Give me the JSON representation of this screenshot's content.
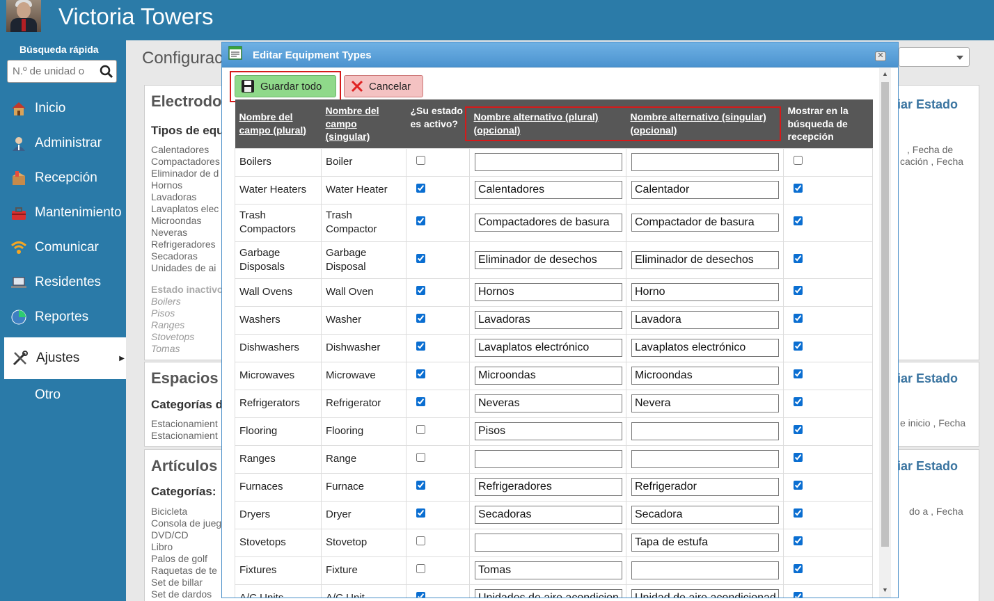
{
  "app": {
    "title": "Victoria Towers"
  },
  "quick_search": {
    "label": "Búsqueda rápida",
    "placeholder": "N.º de unidad o"
  },
  "nav": [
    {
      "label": "Inicio",
      "icon": "house-icon"
    },
    {
      "label": "Administrar",
      "icon": "user-icon"
    },
    {
      "label": "Recepción",
      "icon": "package-icon"
    },
    {
      "label": "Mantenimiento",
      "icon": "toolbox-icon"
    },
    {
      "label": "Comunicar",
      "icon": "wifi-icon"
    },
    {
      "label": "Residentes",
      "icon": "laptop-icon"
    },
    {
      "label": "Reportes",
      "icon": "pie-chart-icon"
    },
    {
      "label": "Ajustes",
      "icon": "tools-icon",
      "active": true
    },
    {
      "label": "Otro"
    }
  ],
  "background": {
    "title": "Configurac",
    "cards": [
      {
        "title": "Electrodo",
        "subtitle": "Tipos de equ",
        "status": "biar Estado",
        "items": [
          "Calentadores",
          "Compactadores",
          "Eliminador de d",
          "Hornos",
          "Lavadoras",
          "Lavaplatos elec",
          "Microondas",
          "Neveras",
          "Refrigeradores",
          "Secadoras",
          "Unidades de ai"
        ],
        "inactive_label": "Estado inactivo",
        "inactive_items": [
          "Boilers",
          "Pisos",
          "Ranges",
          "Stovetops",
          "Tomas"
        ],
        "right_text": [
          ", Fecha de",
          "cación , Fecha"
        ]
      },
      {
        "title": "Espacios",
        "subtitle": "Categorías d",
        "status": "biar Estado",
        "items": [
          "Estacionamient",
          "Estacionamient"
        ],
        "right_text": [
          "e inicio , Fecha"
        ]
      },
      {
        "title": "Artículos",
        "subtitle": "Categorías:",
        "status": "biar Estado",
        "items": [
          "Bicicleta",
          "Consola de jueg",
          "DVD/CD",
          "Libro",
          "Palos de golf",
          "Raquetas de te",
          "Set de billar",
          "Set de dardos"
        ],
        "right_text": [
          "do a , Fecha"
        ]
      }
    ]
  },
  "dialog": {
    "title": "Editar Equipment Types",
    "close": "✕",
    "save_label": "Guardar todo",
    "cancel_label": "Cancelar",
    "columns": [
      "Nombre del campo (plural)",
      "Nombre del campo (singular)",
      "¿Su estado es activo?",
      "Nombre alternativo (plural) (opcional)",
      "Nombre alternativo (singular) (opcional)",
      "Mostrar en la búsqueda de recepción"
    ],
    "rows": [
      {
        "plural": "Boilers",
        "singular": "Boiler",
        "active": false,
        "alt_plural": "",
        "alt_singular": "",
        "show": false
      },
      {
        "plural": "Water Heaters",
        "singular": "Water Heater",
        "active": true,
        "alt_plural": "Calentadores",
        "alt_singular": "Calentador",
        "show": true
      },
      {
        "plural": "Trash Compactors",
        "singular": "Trash Compactor",
        "active": true,
        "alt_plural": "Compactadores de basura",
        "alt_singular": "Compactador de basura",
        "show": true
      },
      {
        "plural": "Garbage Disposals",
        "singular": "Garbage Disposal",
        "active": true,
        "alt_plural": "Eliminador de desechos",
        "alt_singular": "Eliminador de desechos",
        "show": true
      },
      {
        "plural": "Wall Ovens",
        "singular": "Wall Oven",
        "active": true,
        "alt_plural": "Hornos",
        "alt_singular": "Horno",
        "show": true
      },
      {
        "plural": "Washers",
        "singular": "Washer",
        "active": true,
        "alt_plural": "Lavadoras",
        "alt_singular": "Lavadora",
        "show": true
      },
      {
        "plural": "Dishwashers",
        "singular": "Dishwasher",
        "active": true,
        "alt_plural": "Lavaplatos electrónico",
        "alt_singular": "Lavaplatos electrónico",
        "show": true
      },
      {
        "plural": "Microwaves",
        "singular": "Microwave",
        "active": true,
        "alt_plural": "Microondas",
        "alt_singular": "Microondas",
        "show": true
      },
      {
        "plural": "Refrigerators",
        "singular": "Refrigerator",
        "active": true,
        "alt_plural": "Neveras",
        "alt_singular": "Nevera",
        "show": true
      },
      {
        "plural": "Flooring",
        "singular": "Flooring",
        "active": false,
        "alt_plural": "Pisos",
        "alt_singular": "",
        "show": true
      },
      {
        "plural": "Ranges",
        "singular": "Range",
        "active": false,
        "alt_plural": "",
        "alt_singular": "",
        "show": true
      },
      {
        "plural": "Furnaces",
        "singular": "Furnace",
        "active": true,
        "alt_plural": "Refrigeradores",
        "alt_singular": "Refrigerador",
        "show": true
      },
      {
        "plural": "Dryers",
        "singular": "Dryer",
        "active": true,
        "alt_plural": "Secadoras",
        "alt_singular": "Secadora",
        "show": true
      },
      {
        "plural": "Stovetops",
        "singular": "Stovetop",
        "active": false,
        "alt_plural": "",
        "alt_singular": "Tapa de estufa",
        "show": true
      },
      {
        "plural": "Fixtures",
        "singular": "Fixture",
        "active": false,
        "alt_plural": "Tomas",
        "alt_singular": "",
        "show": true
      },
      {
        "plural": "A/C Units",
        "singular": "A/C Unit",
        "active": true,
        "alt_plural": "Unidades de aire acondicionado",
        "alt_singular": "Unidad de aire acondicionado",
        "show": true
      }
    ]
  },
  "colors": {
    "header": "#2b7ba8",
    "grid_header": "#575757",
    "highlight": "#d51a1a",
    "save": "#8fd98a",
    "cancel": "#f4c2c2"
  }
}
